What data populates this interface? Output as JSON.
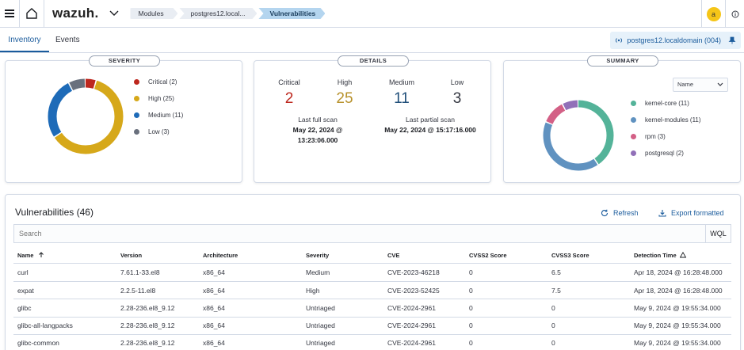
{
  "header": {
    "logo": "wazuh.",
    "breadcrumbs": [
      "Modules",
      "postgres12.local...",
      "Vulnerabilities"
    ],
    "avatar_initial": "a"
  },
  "tabs": [
    "Inventory",
    "Events"
  ],
  "agent": {
    "label": "postgres12.localdomain (004)"
  },
  "severity": {
    "title": "SEVERITY",
    "legend": [
      {
        "label": "Critical (2)",
        "value": 2,
        "color": "#bd271e"
      },
      {
        "label": "High (25)",
        "value": 25,
        "color": "#d6a81a"
      },
      {
        "label": "Medium (11)",
        "value": 11,
        "color": "#1e6bb8"
      },
      {
        "label": "Low (3)",
        "value": 3,
        "color": "#69707d"
      }
    ]
  },
  "details": {
    "title": "DETAILS",
    "counts": [
      {
        "label": "Critical",
        "value": "2",
        "color": "#bd271e"
      },
      {
        "label": "High",
        "value": "25",
        "color": "#b7912b"
      },
      {
        "label": "Medium",
        "value": "11",
        "color": "#1f4e79"
      },
      {
        "label": "Low",
        "value": "3",
        "color": "#343741"
      }
    ],
    "last_full_scan_label": "Last full scan",
    "last_full_scan_line1": "May 22, 2024 @",
    "last_full_scan_line2": "13:23:06.000",
    "last_partial_scan_label": "Last partial scan",
    "last_partial_scan_value": "May 22, 2024 @ 15:17:16.000"
  },
  "summary": {
    "title": "SUMMARY",
    "select_value": "Name",
    "legend": [
      {
        "label": "kernel-core (11)",
        "value": 11,
        "color": "#54b399"
      },
      {
        "label": "kernel-modules (11)",
        "value": 11,
        "color": "#6092c0"
      },
      {
        "label": "rpm (3)",
        "value": 3,
        "color": "#d36086"
      },
      {
        "label": "postgresql (2)",
        "value": 2,
        "color": "#9170b8"
      }
    ]
  },
  "vulnerabilities": {
    "title": "Vulnerabilities (46)",
    "refresh_label": "Refresh",
    "export_label": "Export formatted",
    "search_placeholder": "Search",
    "wql_label": "WQL",
    "columns": [
      "Name",
      "Version",
      "Architecture",
      "Severity",
      "CVE",
      "CVSS2 Score",
      "CVSS3 Score",
      "Detection Time"
    ],
    "rows": [
      [
        "curl",
        "7.61.1-33.el8",
        "x86_64",
        "Medium",
        "CVE-2023-46218",
        "0",
        "6.5",
        "Apr 18, 2024 @ 16:28:48.000"
      ],
      [
        "expat",
        "2.2.5-11.el8",
        "x86_64",
        "High",
        "CVE-2023-52425",
        "0",
        "7.5",
        "Apr 18, 2024 @ 16:28:48.000"
      ],
      [
        "glibc",
        "2.28-236.el8_9.12",
        "x86_64",
        "Untriaged",
        "CVE-2024-2961",
        "0",
        "0",
        "May 9, 2024 @ 19:55:34.000"
      ],
      [
        "glibc-all-langpacks",
        "2.28-236.el8_9.12",
        "x86_64",
        "Untriaged",
        "CVE-2024-2961",
        "0",
        "0",
        "May 9, 2024 @ 19:55:34.000"
      ],
      [
        "glibc-common",
        "2.28-236.el8_9.12",
        "x86_64",
        "Untriaged",
        "CVE-2024-2961",
        "0",
        "0",
        "May 9, 2024 @ 19:55:34.000"
      ]
    ]
  }
}
